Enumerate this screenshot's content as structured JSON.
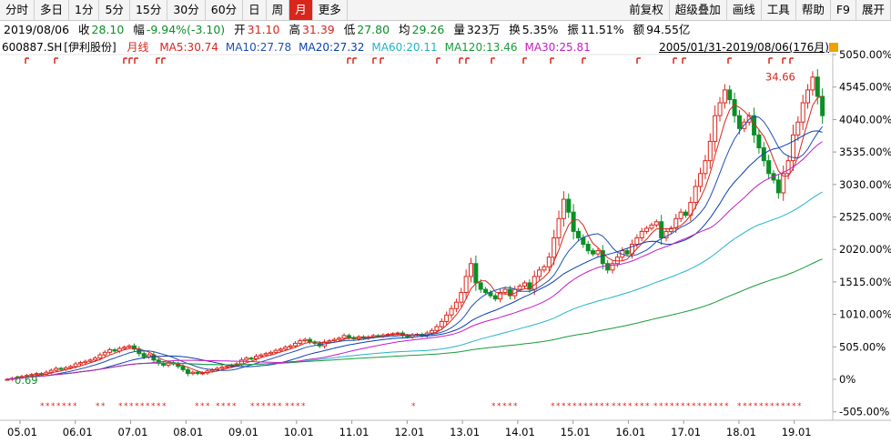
{
  "toolbar": {
    "left": [
      "分时",
      "多日",
      "1分",
      "5分",
      "15分",
      "30分",
      "60分",
      "日",
      "周",
      "月",
      "更多"
    ],
    "active": "月",
    "right": [
      "前复权",
      "超级叠加",
      "画线",
      "工具",
      "帮助",
      "F9",
      "展开"
    ]
  },
  "quote": {
    "date": "2019/08/06",
    "close_label": "收",
    "close": "28.10",
    "change_label": "幅",
    "change": "-9.94%(-3.10)",
    "open_label": "开",
    "open": "31.10",
    "high_label": "高",
    "high": "31.39",
    "low_label": "低",
    "low": "27.80",
    "avg_label": "均",
    "avg": "29.26",
    "volume_label": "量",
    "volume": "323万",
    "turnover_label": "换",
    "turnover": "5.35%",
    "amplitude_label": "振",
    "amplitude": "11.51%",
    "amount_label": "额",
    "amount": "94.55亿"
  },
  "chart_data": {
    "type": "candlestick",
    "stock": "600887.SH",
    "stock_name": "[伊利股份]",
    "period": "月线",
    "range_label": "2005/01/31-2019/08/06(176月)",
    "y_unit": "%",
    "yticks": [
      "5050.00%",
      "4545.00%",
      "4040.00%",
      "3535.00%",
      "3030.00%",
      "2525.00%",
      "2020.00%",
      "1515.00%",
      "1010.00%",
      "505.00%",
      "0%",
      "-505.00%"
    ],
    "yvals": [
      5050,
      4545,
      4040,
      3535,
      3030,
      2525,
      2020,
      1515,
      1010,
      505,
      0,
      -505
    ],
    "xticks": [
      "05.01",
      "06.01",
      "07.01",
      "08.01",
      "09.01",
      "10.01",
      "11.01",
      "12.01",
      "13.01",
      "14.01",
      "15.01",
      "16.01",
      "17.01",
      "18.01",
      "19.01"
    ],
    "ylim": [
      -505,
      5050
    ],
    "annotations": {
      "max": "34.66",
      "min": "0.69"
    },
    "ma": [
      {
        "name": "MA5",
        "value": "30.74",
        "color": "#d9261c"
      },
      {
        "name": "MA10",
        "value": "27.78",
        "color": "#1f4fb4"
      },
      {
        "name": "MA20",
        "value": "27.32",
        "color": "#0a3fb0"
      },
      {
        "name": "MA60",
        "value": "20.11",
        "color": "#21b4c9"
      },
      {
        "name": "MA120",
        "value": "13.46",
        "color": "#1a9b3a"
      },
      {
        "name": "MA30",
        "value": "25.81",
        "color": "#c61bc6"
      }
    ],
    "close_pct": [
      0,
      15,
      30,
      45,
      60,
      75,
      90,
      80,
      110,
      140,
      170,
      155,
      180,
      200,
      240,
      260,
      280,
      300,
      330,
      380,
      420,
      460,
      440,
      480,
      500,
      520,
      470,
      400,
      350,
      380,
      300,
      250,
      220,
      260,
      240,
      200,
      150,
      90,
      110,
      90,
      100,
      130,
      150,
      170,
      190,
      200,
      220,
      240,
      300,
      330,
      320,
      360,
      380,
      400,
      420,
      450,
      470,
      500,
      520,
      560,
      600,
      620,
      580,
      560,
      520,
      580,
      600,
      620,
      640,
      680,
      650,
      630,
      660,
      640,
      660,
      680,
      670,
      690,
      700,
      710,
      720,
      680,
      660,
      690,
      700,
      680,
      720,
      760,
      820,
      900,
      1000,
      1100,
      1200,
      1350,
      1600,
      1800,
      1500,
      1400,
      1350,
      1300,
      1250,
      1350,
      1400,
      1300,
      1400,
      1450,
      1500,
      1400,
      1600,
      1700,
      1750,
      1900,
      2200,
      2500,
      2800,
      2600,
      2300,
      2200,
      2100,
      2000,
      1950,
      2000,
      1800,
      1700,
      1800,
      1900,
      2000,
      1950,
      2100,
      2200,
      2300,
      2350,
      2400,
      2450,
      2200,
      2300,
      2350,
      2500,
      2600,
      2550,
      2750,
      3000,
      3200,
      3400,
      3700,
      4100,
      4300,
      4500,
      4350,
      4100,
      3900,
      4000,
      4100,
      3800,
      3600,
      3400,
      3200,
      3100,
      2900,
      3200,
      3400,
      3800,
      4000,
      4300,
      4500,
      4700,
      4400,
      4100
    ]
  }
}
